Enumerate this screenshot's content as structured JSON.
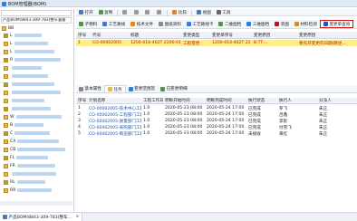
{
  "app": {
    "title": "BOM管理器(BOM)"
  },
  "left": {
    "search_placeholder": "",
    "filter_label": "产品BOM(8843-309-783)整车置备",
    "tree_root": "BB",
    "tree_items": [
      "L",
      "L",
      "L",
      "R",
      "",
      "",
      "",
      "",
      "",
      "",
      "W",
      "B",
      "C",
      "CA",
      "CB",
      "FL",
      "FR",
      "",
      "RL",
      "RR"
    ]
  },
  "toolbar1": {
    "items": [
      "打开",
      "复制",
      "",
      "",
      "",
      "",
      "比较",
      "视图",
      "工具"
    ]
  },
  "toolbar2": {
    "items": [
      "子物料",
      "工艺路线",
      "技术文件",
      "图纸资料",
      "工艺路线卡",
      "二维图档",
      "三维图档",
      "装图",
      "材料检测",
      "变更单查询"
    ]
  },
  "top_grid": {
    "headers": [
      "序号",
      "代号",
      "标题",
      "变更类型",
      "变更单序号",
      "变更原因",
      "变更原因"
    ],
    "rows": [
      [
        "1",
        "CO-00002005",
        "1200-016-462T 2200-011-...",
        "工程变更",
        "1200-016-462T 2200-011-C33",
        "B.TT-...",
        "要先开变更的日期/路径..."
      ]
    ]
  },
  "middle_tabs": [
    "基本属性",
    "任务",
    "变更范围签",
    "已变更明细"
  ],
  "bottom_grid": {
    "headers": [
      "序号",
      "计划名称",
      "工程工作日",
      "明晰开始时间",
      "明晰完成时间",
      "执行状态",
      "执行人",
      "分派人"
    ],
    "rows": [
      [
        "1",
        "CO-00002005-技术中心工程...",
        "1.0",
        "2020-05-23 08:00",
        "2020-05-24 17:00",
        "已完成",
        "罗飞",
        "朱正"
      ],
      [
        "2",
        "CO-00002005-工程部门工程...",
        "1.0",
        "2020-05-23 08:00",
        "2020-05-24 17:00",
        "已完成",
        "吕鑫",
        "朱正"
      ],
      [
        "3",
        "CO-00002005-质量部门工程...",
        "1.0",
        "2020-05-23 08:00",
        "2020-05-24 17:00",
        "已完成",
        "李影",
        "朱正"
      ],
      [
        "4",
        "CO-00002005-采购部门工程...",
        "1.0",
        "2020-05-23 08:00",
        "2020-05-24 17:00",
        "已完成",
        "付雪飞",
        "朱正"
      ],
      [
        "5",
        "CO-00002005-制造部门工程...",
        "1.0",
        "2020-05-23 08:00",
        "2020-05-24 17:00",
        "未接收",
        "黄红",
        "朱正"
      ]
    ]
  },
  "status": {
    "tab": "产品BOM(8843-309-783)整车..."
  },
  "colors": {
    "accent": "#3a7bd5",
    "highlight": "#ffec8a",
    "red": "#c0121b"
  }
}
